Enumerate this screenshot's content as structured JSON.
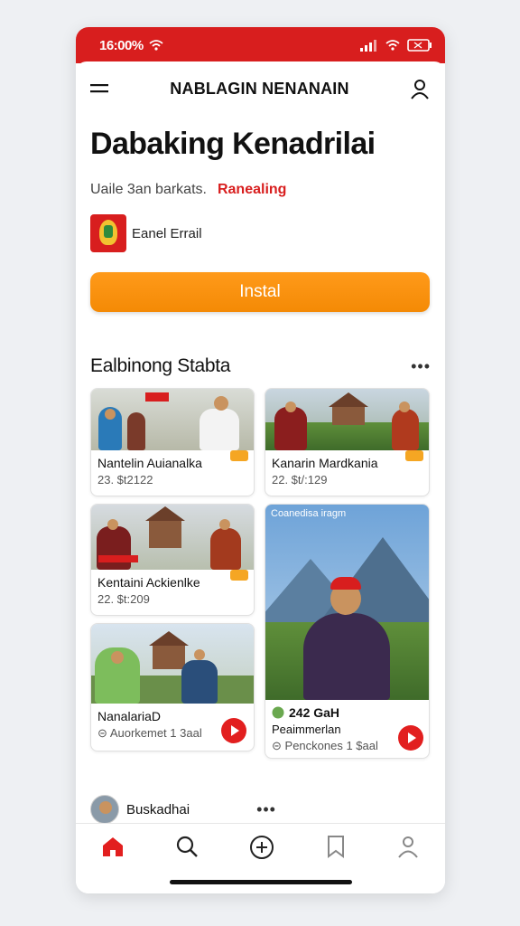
{
  "status": {
    "time": "16:00%",
    "signal_icon": "signal-icon",
    "wifi_icon": "wifi-icon",
    "battery_icon": "battery-icon"
  },
  "nav": {
    "title": "NABLAGIN NENANAIN",
    "menu_icon": "menu-icon",
    "profile_icon": "profile-icon"
  },
  "app": {
    "title": "Dabaking Kenadrilai",
    "subtitle": "Uaile 3an barkats.",
    "category": "Ranealing",
    "developer": "Eanel Errail",
    "install_label": "Instal"
  },
  "section": {
    "title": "Ealbinong Stabta",
    "cards": [
      {
        "title": "Nantelin Auianalka",
        "meta": "23. $t2122"
      },
      {
        "title": "Kanarin Mardkania",
        "meta": "22. $t/:129"
      },
      {
        "title": "Kentaini Ackienlke",
        "meta": "22. $t:209"
      },
      {
        "title": "NanalariaD",
        "meta": "Auorkemet 1 3aal"
      },
      {
        "overlay": "Coanedisa iragm",
        "count": "242 GaH",
        "title": "Peaimmerlan",
        "meta": "Penckones 1 $aal"
      }
    ]
  },
  "next_section": {
    "name": "Buskadhai"
  },
  "bottom_nav": [
    "home-icon",
    "search-icon",
    "add-icon",
    "bookmark-icon",
    "profile-icon"
  ],
  "colors": {
    "brand": "#d81e1e",
    "accent": "#f48a05"
  }
}
